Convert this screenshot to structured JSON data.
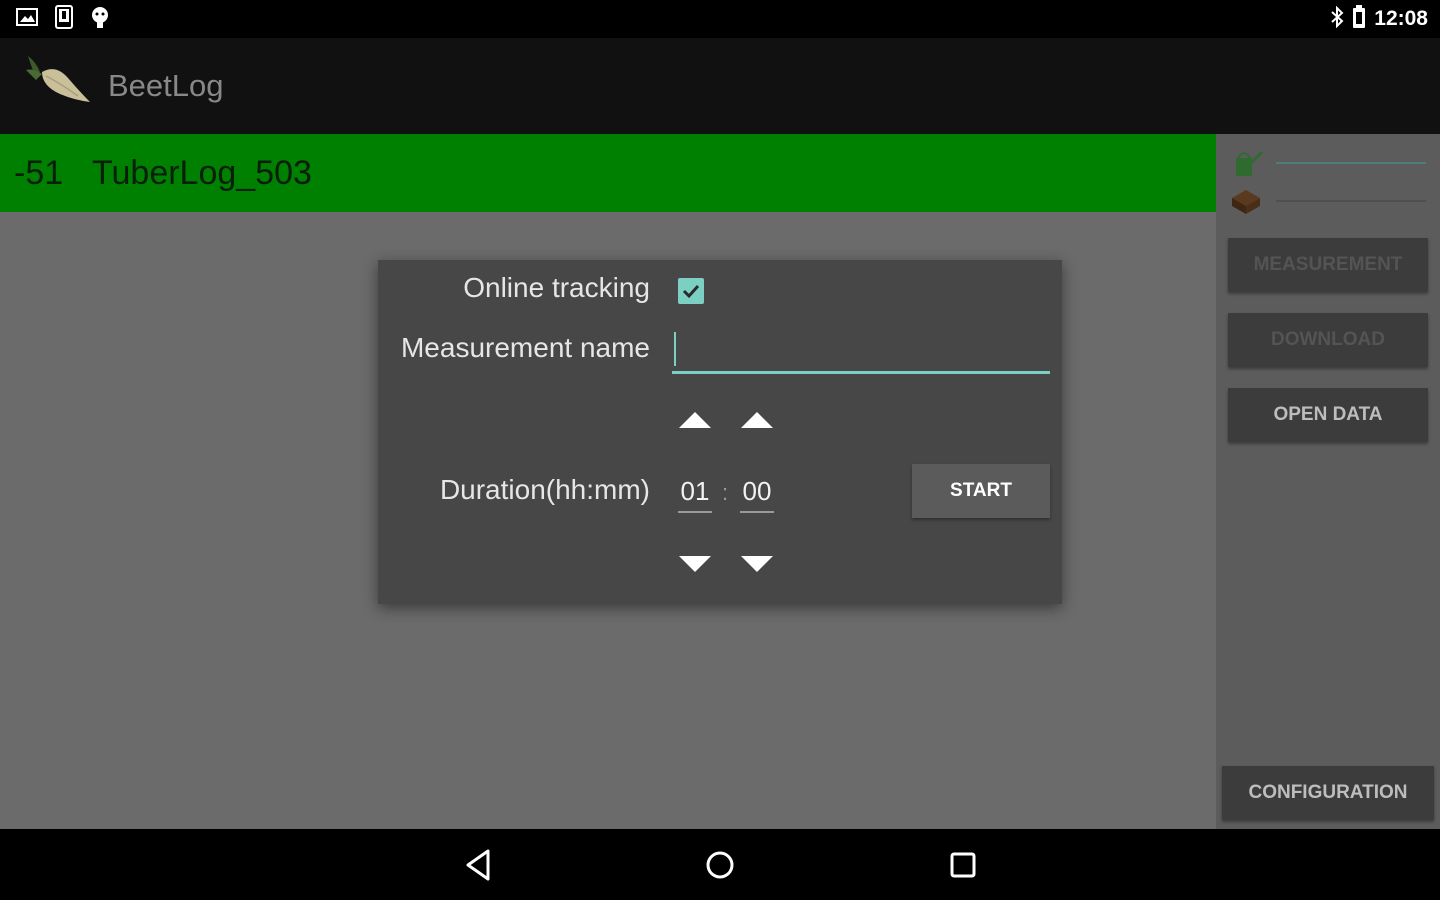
{
  "status_bar": {
    "time": "12:08",
    "left_icons": [
      "image-icon",
      "screenshot-icon",
      "android-debug-icon"
    ],
    "right_icons": [
      "bluetooth-icon",
      "battery-icon"
    ]
  },
  "action_bar": {
    "title": "BeetLog",
    "logo_icon": "beet-logo-icon"
  },
  "device_bar": {
    "rssi": "-51",
    "name": "TuberLog_503",
    "color": "#008000"
  },
  "dialog": {
    "online_tracking_label": "Online tracking",
    "online_tracking_checked": true,
    "measurement_name_label": "Measurement name",
    "measurement_name_value": "",
    "duration_label": "Duration(hh:mm)",
    "hours": "01",
    "separator": ":",
    "minutes": "00",
    "start_label": "START",
    "accent_color": "#7ccfc3"
  },
  "side_panel": {
    "buttons": {
      "measurement": "MEASUREMENT",
      "download": "DOWNLOAD",
      "open_data": "OPEN DATA",
      "configuration": "CONFIGURATION"
    },
    "icons": [
      "watering-can-icon",
      "soil-sensor-icon"
    ]
  },
  "nav_bar": {
    "icons": [
      "back-icon",
      "home-icon",
      "recent-apps-icon"
    ]
  }
}
